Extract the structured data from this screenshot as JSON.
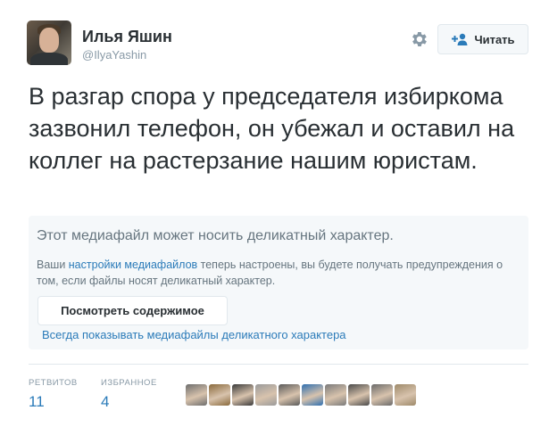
{
  "author": {
    "name": "Илья Яшин",
    "handle": "@IlyaYashin"
  },
  "actions": {
    "settings_icon": "gear-icon",
    "follow_label": "Читать",
    "follow_icon": "follow-plus-person-icon"
  },
  "tweet": {
    "text": "В разгар спора у председателя избиркома зазвонил телефон, он убежал и оставил на коллег на растерзание нашим юристам."
  },
  "sensitive_media": {
    "title": "Этот медиафайл может носить деликатный характер.",
    "body_prefix": "Ваши ",
    "body_link": "настройки медиафайлов",
    "body_suffix": " теперь настроены, вы будете получать предупреждения о том, если файлы носят деликатный характер.",
    "view_button": "Посмотреть содержимое",
    "always_show_link": "Всегда показывать медиафайлы деликатного характера"
  },
  "stats": {
    "retweets_label": "РЕТВИТОВ",
    "retweets_value": "11",
    "favorites_label": "ИЗБРАННОЕ",
    "favorites_value": "4"
  },
  "favorited_by": {
    "colors": [
      "#6d6d6d",
      "#8a6a3c",
      "#3a3a3a",
      "#9a9a9a",
      "#5a5a5a",
      "#2f6fb0",
      "#7a7a7a",
      "#4a4a4a",
      "#6a6a6a",
      "#9e8a6a"
    ]
  },
  "colors": {
    "link": "#2b7bb9",
    "muted": "#8899a6",
    "text": "#292f33",
    "panel": "#f5f8fa"
  }
}
